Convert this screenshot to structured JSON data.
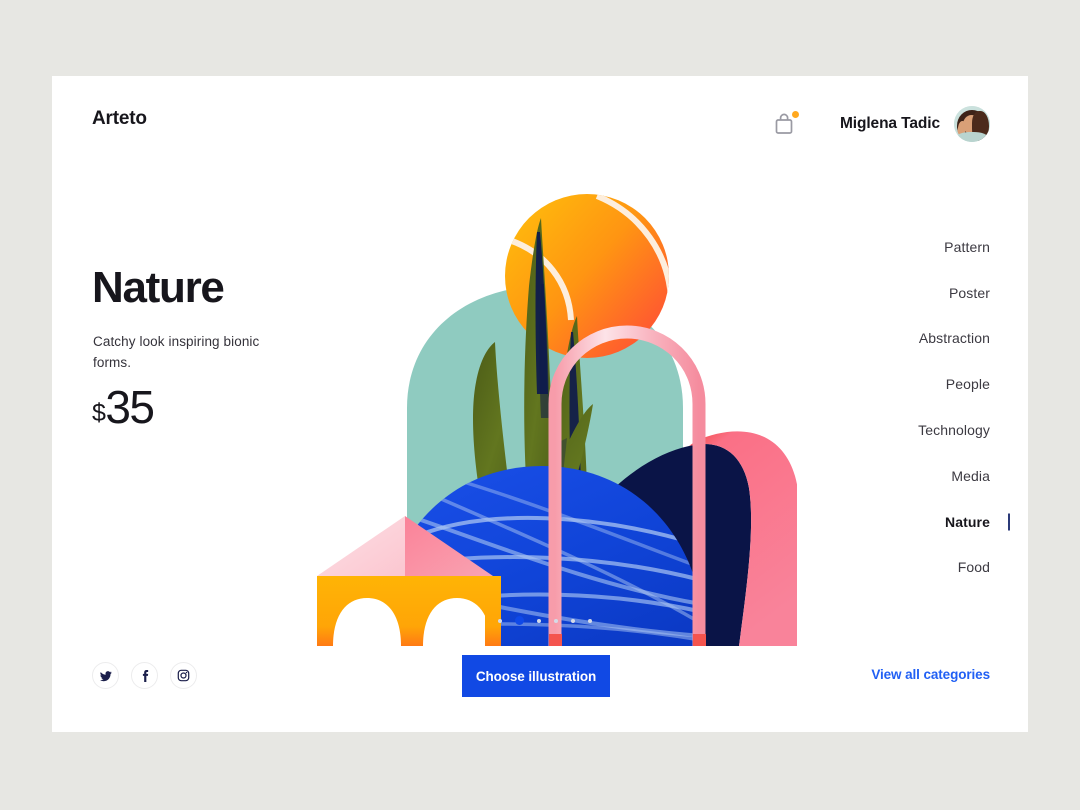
{
  "background_color": "#e7e7e3",
  "card_color": "#ffffff",
  "header": {
    "logo": "Arteto",
    "cart_icon": "shopping-bag-icon",
    "cart_badge_color": "#ffa81f",
    "user_name": "Miglena Tadic",
    "avatar_icon": "user-avatar-photo"
  },
  "hero": {
    "title": "Nature",
    "subtitle": "Catchy look inspiring bionic forms.",
    "currency": "$",
    "price": "35"
  },
  "categories": [
    {
      "label": "Pattern",
      "active": false
    },
    {
      "label": "Poster",
      "active": false
    },
    {
      "label": "Abstraction",
      "active": false
    },
    {
      "label": "People",
      "active": false
    },
    {
      "label": "Technology",
      "active": false
    },
    {
      "label": "Media",
      "active": false
    },
    {
      "label": "Nature",
      "active": true
    },
    {
      "label": "Food",
      "active": false
    }
  ],
  "active_indicator_color": "#2b3a78",
  "carousel": {
    "total_dots": 6,
    "active_index": 1,
    "active_dot_color": "#0f49e8",
    "inactive_dot_color": "#d5dae6"
  },
  "footer": {
    "socials": [
      {
        "name": "twitter-icon",
        "glyph": "twitter"
      },
      {
        "name": "facebook-icon",
        "glyph": "f"
      },
      {
        "name": "instagram-icon",
        "glyph": "instagram"
      }
    ],
    "cta_label": "Choose illustration",
    "cta_color": "#1149e4",
    "view_all_label": "View all categories",
    "view_all_color": "#2160f4"
  },
  "illustration": {
    "name": "nature-abstract-illustration",
    "shapes": [
      {
        "name": "mint-arch",
        "color": "#8fcbc0"
      },
      {
        "name": "teal-band",
        "color": "#4f8fa0"
      },
      {
        "name": "tennis-ball",
        "colors": [
          "#ffab11",
          "#ff4b3c",
          "#fdeedd"
        ]
      },
      {
        "name": "magenta-crescent",
        "color": "#c2186a"
      },
      {
        "name": "olive-leaves",
        "color": "#5b6c1c"
      },
      {
        "name": "navy-leaf-stripes",
        "color": "#0d1a4d"
      },
      {
        "name": "navy-wave",
        "color": "#0a1447"
      },
      {
        "name": "pink-ribbon",
        "color": "#f9798e"
      },
      {
        "name": "red-ribbon-accent",
        "color": "#f3463f"
      },
      {
        "name": "blue-string-dome",
        "color": "#1148e0"
      },
      {
        "name": "string-lines",
        "color": "#a9c4f2"
      },
      {
        "name": "pink-arch-rail",
        "color": "#f7a8b4"
      },
      {
        "name": "yellow-block-arches",
        "color": "#ffb000"
      },
      {
        "name": "pink-pyramid",
        "colors": [
          "#fbd3da",
          "#f9829a"
        ]
      }
    ]
  }
}
